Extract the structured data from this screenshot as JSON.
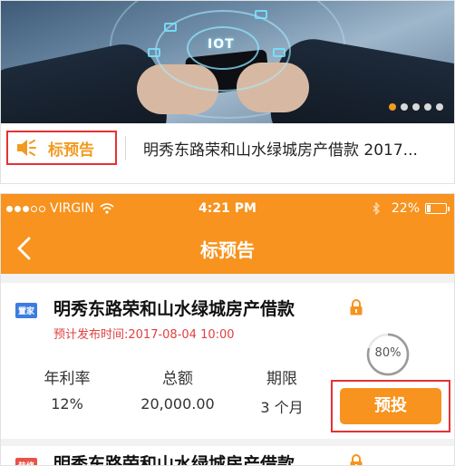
{
  "banner": {
    "overlay_text": "IOT",
    "carousel_dots": 5,
    "active_dot": 0
  },
  "notice": {
    "label": "标预告",
    "text": "明秀东路荣和山水绿城房产借款 2017..."
  },
  "status_bar": {
    "carrier": "VIRGIN",
    "time": "4:21 PM",
    "battery": "22%",
    "battery_level": 0.22
  },
  "nav": {
    "title": "标预告"
  },
  "loan": {
    "tag": "置家",
    "title": "明秀东路荣和山水绿城房产借款",
    "date_label": "预计发布时间:",
    "date_value": "2017-08-04 10:00",
    "progress_text": "80%",
    "progress": 0.8,
    "stats": [
      {
        "label": "年利率",
        "value": "12%"
      },
      {
        "label": "总额",
        "value": "20,000.00"
      },
      {
        "label": "期限",
        "value": "3 个月"
      }
    ],
    "invest_label": "预投"
  },
  "loan_next": {
    "tag": "装修",
    "title": "明秀东路荣和山水绿城房产借款"
  },
  "colors": {
    "accent": "#f7931e",
    "highlight_border": "#e53232",
    "date_red": "#e14040",
    "tag_blue": "#3b7de0"
  }
}
